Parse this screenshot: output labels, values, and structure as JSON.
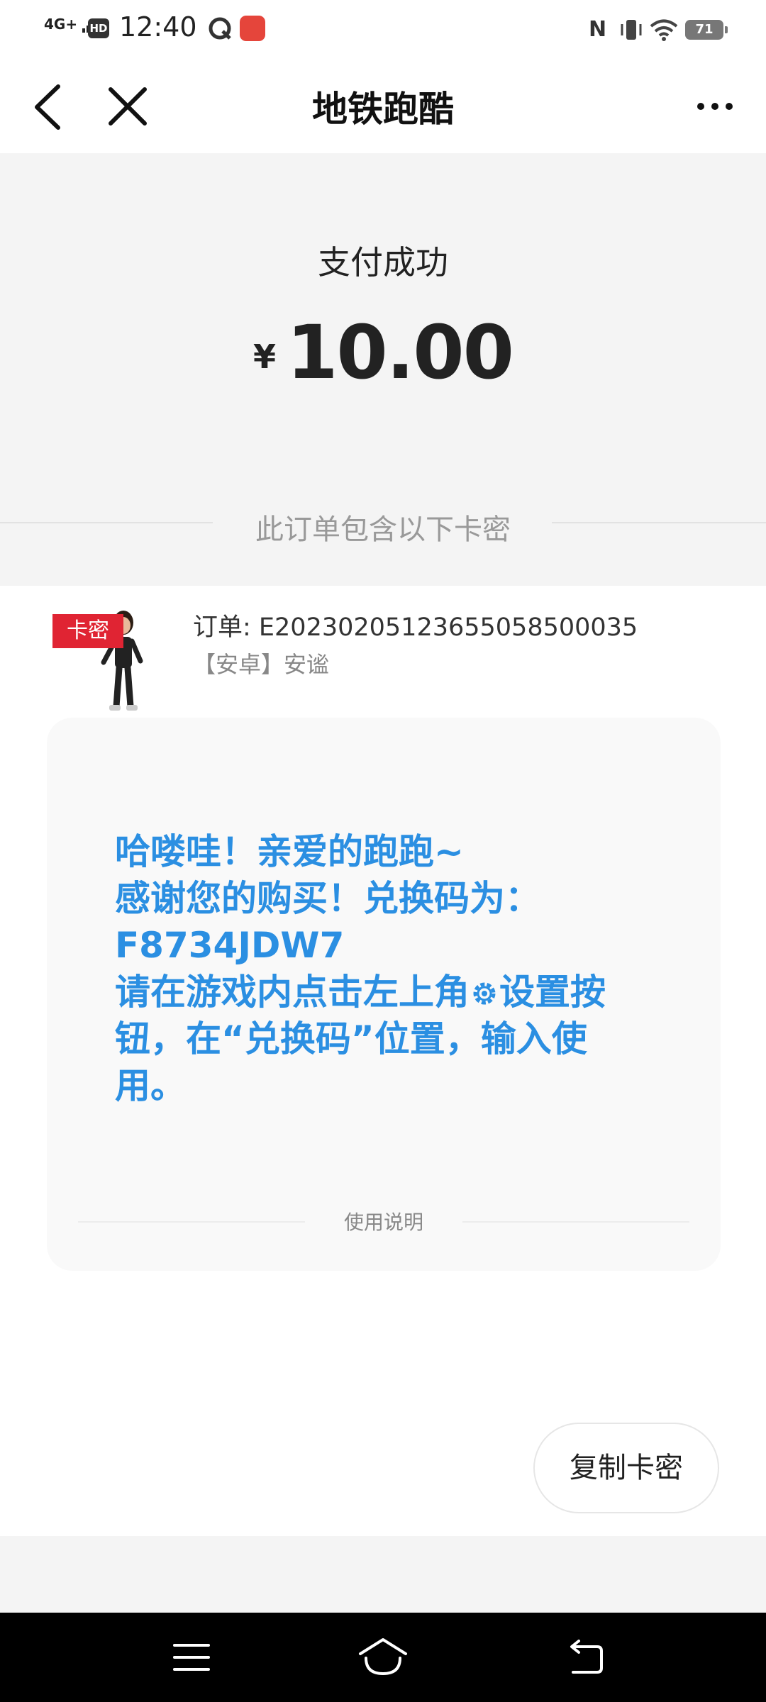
{
  "status_bar": {
    "network": "4G+",
    "hd": "HD",
    "time": "12:40",
    "battery": "71"
  },
  "nav": {
    "title": "地铁跑酷"
  },
  "payment": {
    "status": "支付成功",
    "currency": "¥",
    "amount": "10.00",
    "section_label": "此订单包含以下卡密"
  },
  "order": {
    "badge": "卡密",
    "number": "订单: E20230205123655058500035",
    "platform": "【安卓】安谧"
  },
  "message": {
    "line1": "哈喽哇！亲爱的跑跑~",
    "line2": "感谢您的购买！兑换码为：",
    "line3": "F8734JDW7",
    "line4_a": "请在游戏内点击左上角",
    "line4_b": "设置按",
    "line5": "钮，在“兑换码”位置，输入使",
    "line6": "用。",
    "usage_label": "使用说明"
  },
  "actions": {
    "copy_label": "复制卡密"
  },
  "colors": {
    "message_text": "#2b8fe2",
    "badge": "#e02433"
  }
}
